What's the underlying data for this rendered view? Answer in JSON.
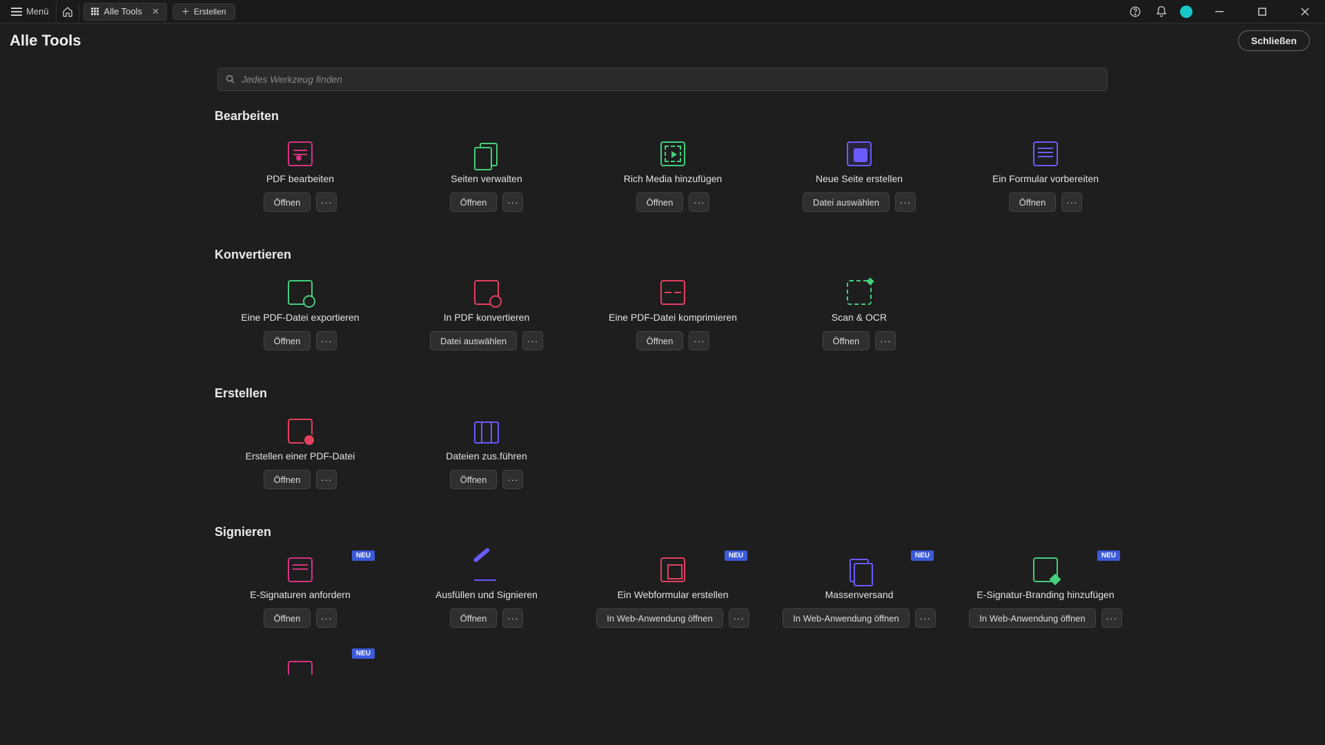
{
  "titlebar": {
    "menu_label": "Menü",
    "tab_label": "Alle Tools",
    "create_label": "Erstellen"
  },
  "header": {
    "title": "Alle Tools",
    "close_label": "Schließen"
  },
  "search": {
    "placeholder": "Jedes Werkzeug finden"
  },
  "labels": {
    "open": "Öffnen",
    "select_file": "Datei auswählen",
    "open_web": "In Web-Anwendung öffnen",
    "more": "···",
    "new_badge": "NEU"
  },
  "sections": [
    {
      "title": "Bearbeiten",
      "tools": [
        {
          "name": "PDF bearbeiten",
          "icon": "ic-edit",
          "primary": "open"
        },
        {
          "name": "Seiten verwalten",
          "icon": "ic-pages",
          "primary": "open"
        },
        {
          "name": "Rich Media hinzufügen",
          "icon": "ic-media",
          "primary": "open"
        },
        {
          "name": "Neue Seite erstellen",
          "icon": "ic-newpage",
          "primary": "select_file"
        },
        {
          "name": "Ein Formular vorbereiten",
          "icon": "ic-form",
          "primary": "open"
        }
      ]
    },
    {
      "title": "Konvertieren",
      "tools": [
        {
          "name": "Eine PDF-Datei exportieren",
          "icon": "ic-export",
          "primary": "open"
        },
        {
          "name": "In PDF konvertieren",
          "icon": "ic-topdf",
          "primary": "select_file"
        },
        {
          "name": "Eine PDF-Datei komprimieren",
          "icon": "ic-compress",
          "primary": "open"
        },
        {
          "name": "Scan & OCR",
          "icon": "ic-scan",
          "primary": "open"
        }
      ]
    },
    {
      "title": "Erstellen",
      "tools": [
        {
          "name": "Erstellen einer PDF-Datei",
          "icon": "ic-createpdf",
          "primary": "open"
        },
        {
          "name": "Dateien zus.führen",
          "icon": "ic-merge",
          "primary": "open"
        }
      ]
    },
    {
      "title": "Signieren",
      "tools": [
        {
          "name": "E-Signaturen anfordern",
          "icon": "ic-reqsig",
          "primary": "open",
          "badge": true
        },
        {
          "name": "Ausfüllen und Signieren",
          "icon": "ic-fillsign",
          "primary": "open"
        },
        {
          "name": "Ein Webformular erstellen",
          "icon": "ic-webform",
          "primary": "open_web",
          "badge": true
        },
        {
          "name": "Massenversand",
          "icon": "ic-bulk",
          "primary": "open_web",
          "badge": true
        },
        {
          "name": "E-Signatur-Branding hinzufügen",
          "icon": "ic-brand",
          "primary": "open_web",
          "badge": true
        },
        {
          "name": "",
          "icon": "ic-partial",
          "primary": "",
          "badge": true,
          "partial": true
        }
      ]
    }
  ]
}
